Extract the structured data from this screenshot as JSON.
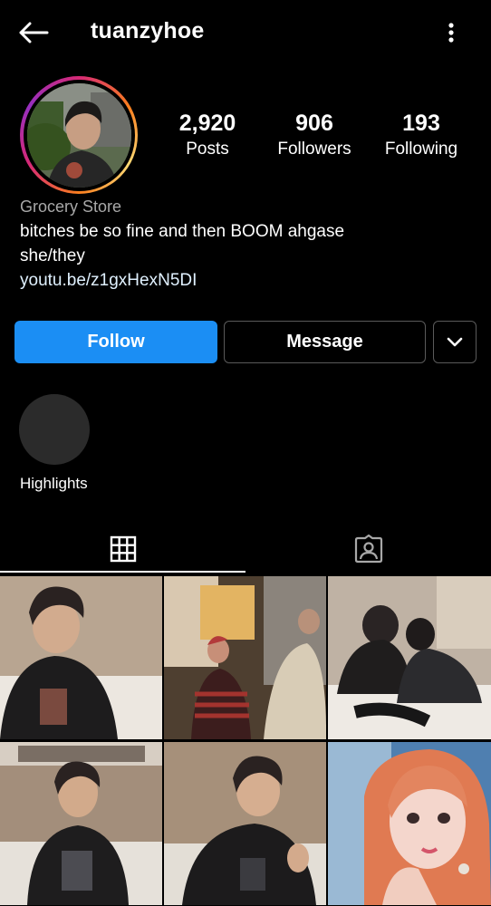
{
  "header": {
    "username": "tuanzyhoe",
    "back_icon": "arrow-left-icon",
    "more_icon": "vertical-ellipsis-icon"
  },
  "stats": [
    {
      "value": "2,920",
      "label": "Posts"
    },
    {
      "value": "906",
      "label": "Followers"
    },
    {
      "value": "193",
      "label": "Following"
    }
  ],
  "bio": {
    "category": "Grocery Store",
    "line1": "bitches be so fine and then BOOM ahgase",
    "line2": "she/they",
    "link": "youtu.be/z1gxHexN5DI"
  },
  "actions": {
    "follow": "Follow",
    "message": "Message",
    "more_icon": "chevron-down-icon"
  },
  "highlights": {
    "label": "Highlights"
  },
  "tabs": [
    {
      "icon": "grid-icon"
    },
    {
      "icon": "tagged-person-icon"
    }
  ],
  "colors": {
    "accent": "#1b8ef4",
    "background": "#000000",
    "secondary_text": "#a8a8a8"
  }
}
